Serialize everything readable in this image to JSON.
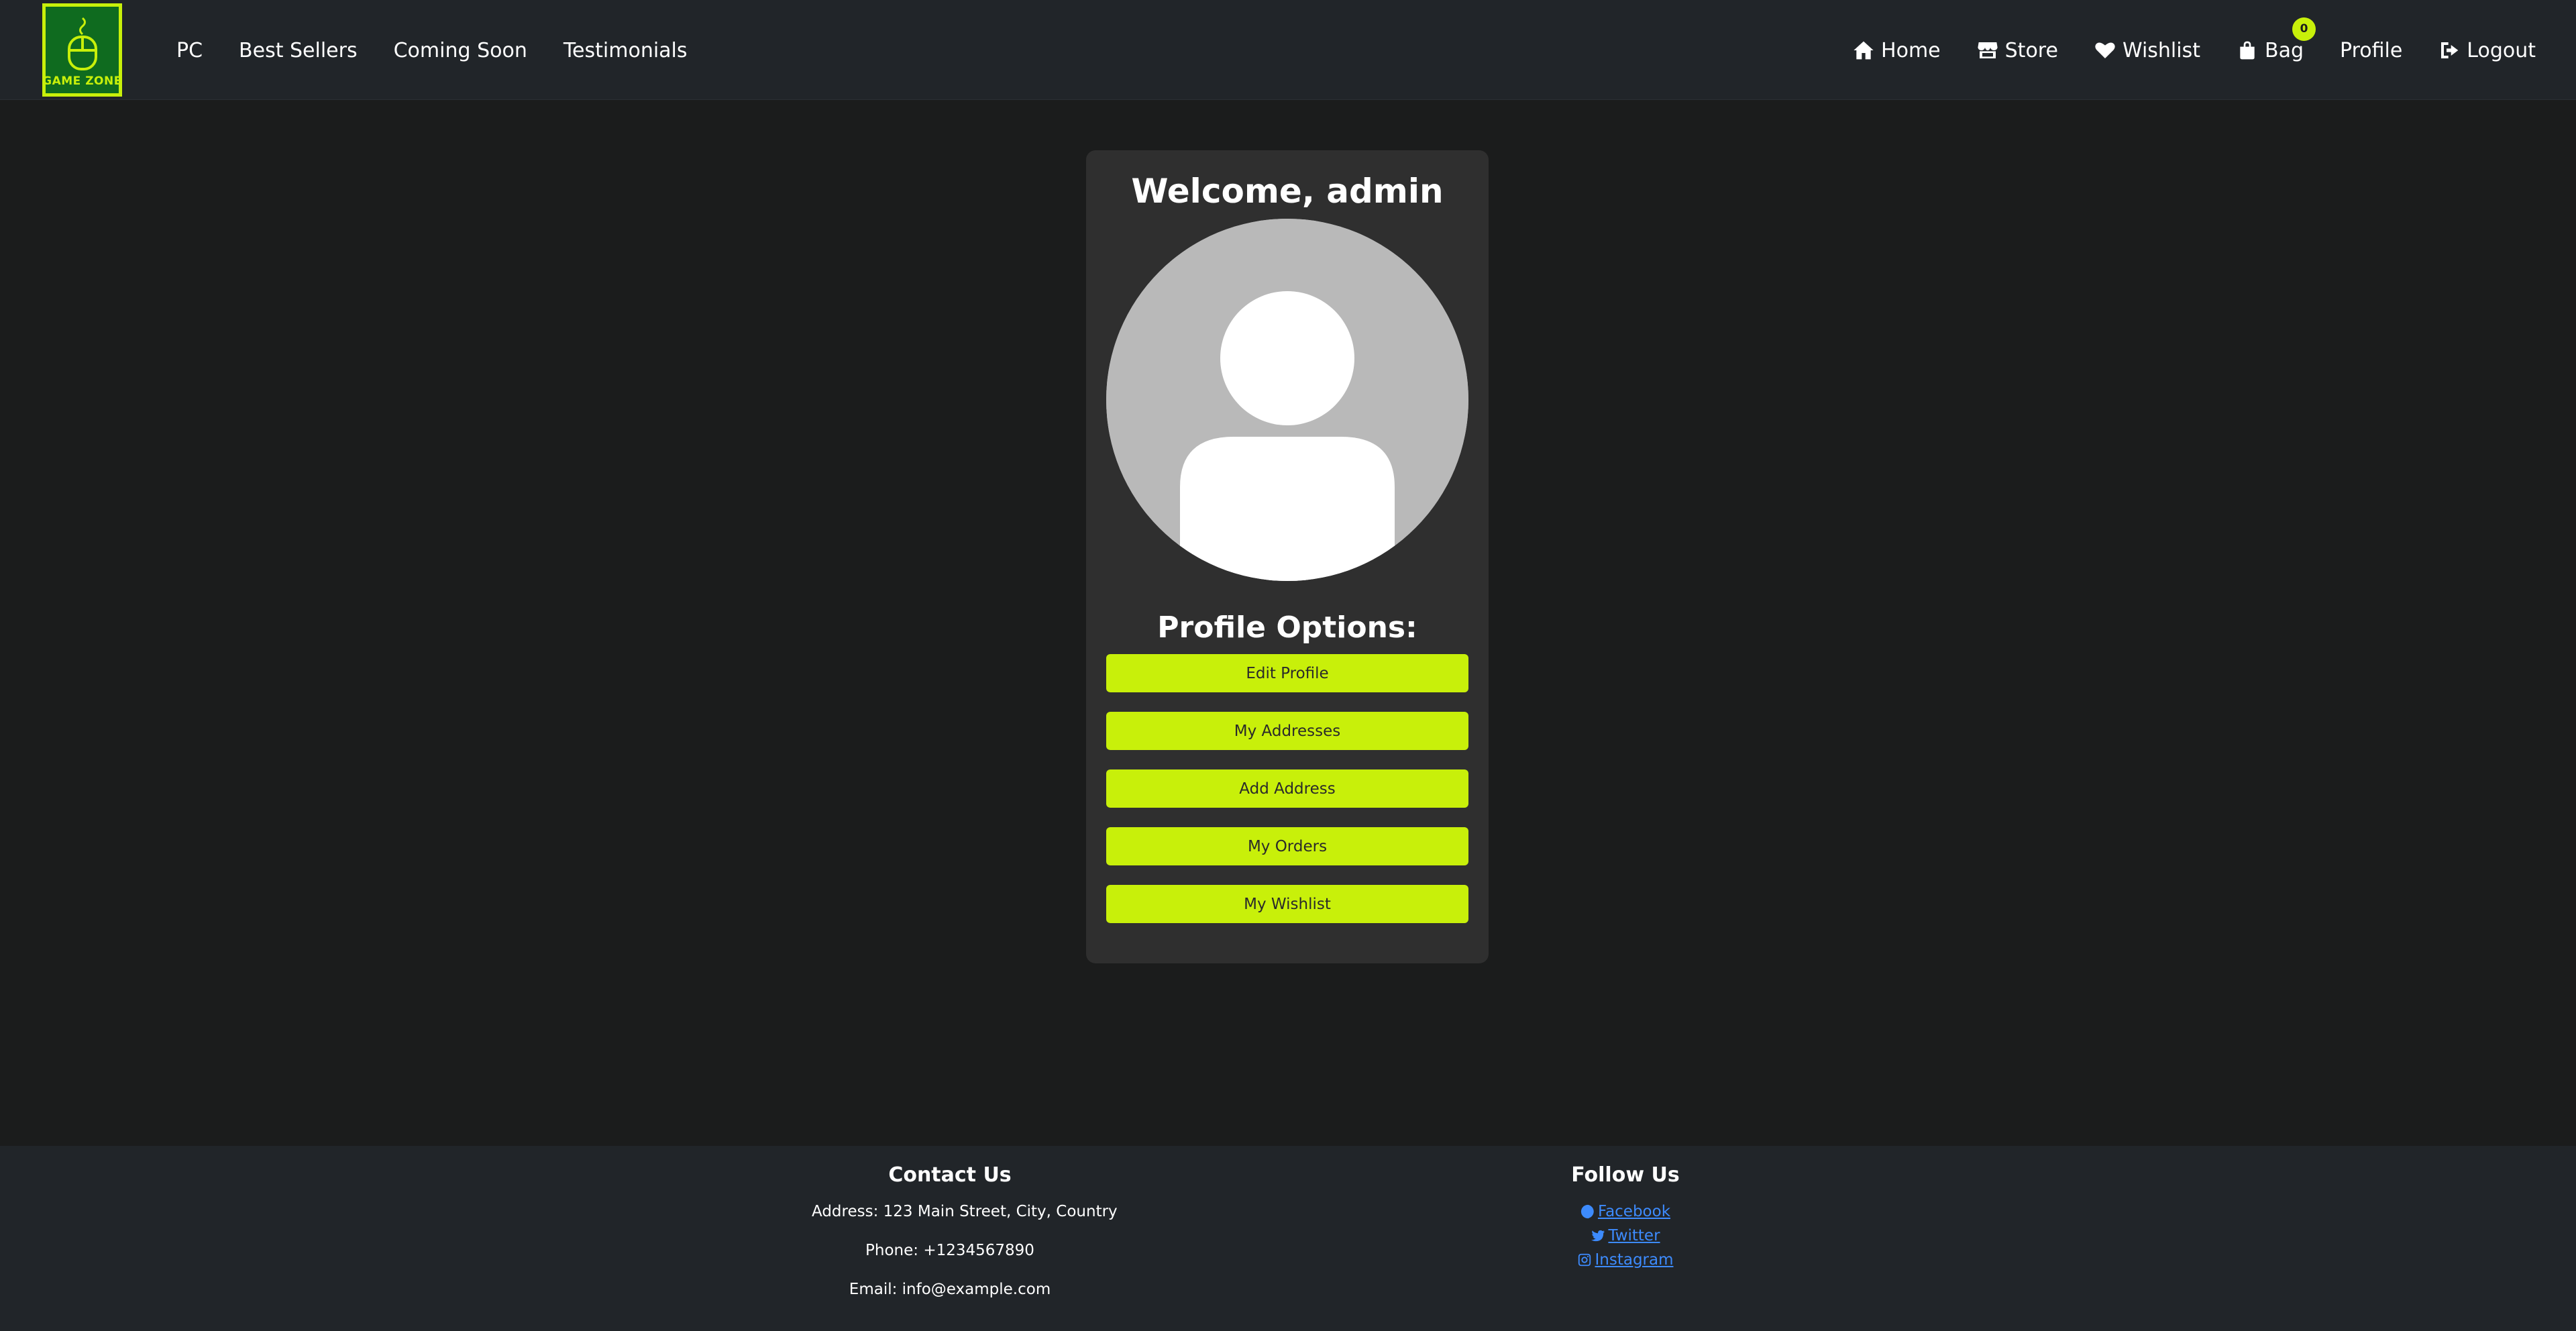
{
  "brand": {
    "logo_text": "GAME ZONE",
    "accent": "#c8f00a",
    "logo_bg": "#0f6b1f"
  },
  "nav": {
    "left_links": [
      "PC",
      "Best Sellers",
      "Coming Soon",
      "Testimonials"
    ],
    "right_links": {
      "home": {
        "label": "Home",
        "icon": "home-icon"
      },
      "store": {
        "label": "Store",
        "icon": "store-icon"
      },
      "wishlist": {
        "label": "Wishlist",
        "icon": "heart-icon"
      },
      "bag": {
        "label": "Bag",
        "icon": "bag-icon",
        "count": "0"
      },
      "profile": {
        "label": "Profile"
      },
      "logout": {
        "label": "Logout",
        "icon": "logout-icon"
      }
    }
  },
  "profile": {
    "welcome": "Welcome, admin",
    "options_title": "Profile Options:",
    "options": [
      "Edit Profile",
      "My Addresses",
      "Add Address",
      "My Orders",
      "My Wishlist"
    ]
  },
  "footer": {
    "contact": {
      "title": "Contact Us",
      "address": "Address: 123 Main Street, City, Country",
      "phone": "Phone: +1234567890",
      "email": "Email: info@example.com"
    },
    "follow": {
      "title": "Follow Us",
      "links": [
        {
          "label": " Facebook",
          "icon": "facebook-icon"
        },
        {
          "label": " Twitter",
          "icon": "twitter-icon"
        },
        {
          "label": " Instagram",
          "icon": "instagram-icon"
        }
      ]
    }
  }
}
